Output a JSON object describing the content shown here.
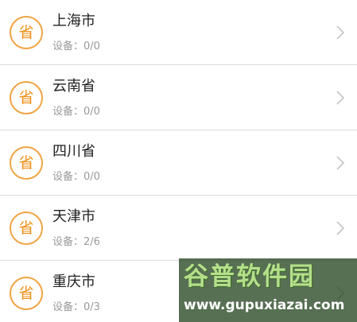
{
  "badge_text": "省",
  "items": [
    {
      "name": "上海市",
      "devices_label": "设备：",
      "devices": "0/0",
      "chevron": "chevron-right-icon"
    },
    {
      "name": "云南省",
      "devices_label": "设备：",
      "devices": "0/0",
      "chevron": "chevron-right-icon"
    },
    {
      "name": "四川省",
      "devices_label": "设备：",
      "devices": "0/0",
      "chevron": "chevron-right-icon"
    },
    {
      "name": "天津市",
      "devices_label": "设备：",
      "devices": "2/6",
      "chevron": "chevron-right-icon"
    },
    {
      "name": "重庆市",
      "devices_label": "设备：",
      "devices": "0/3",
      "chevron": "chevron-right-icon"
    }
  ],
  "watermark": {
    "title": "谷普软件园",
    "url": "www.gupuxiazai.com"
  },
  "colors": {
    "accent": "#ef8f17",
    "badge_border": "#f0a443",
    "title": "#222222",
    "subtitle": "#999999",
    "divider": "#dcdcdc",
    "chevron": "#c4c4c4"
  }
}
